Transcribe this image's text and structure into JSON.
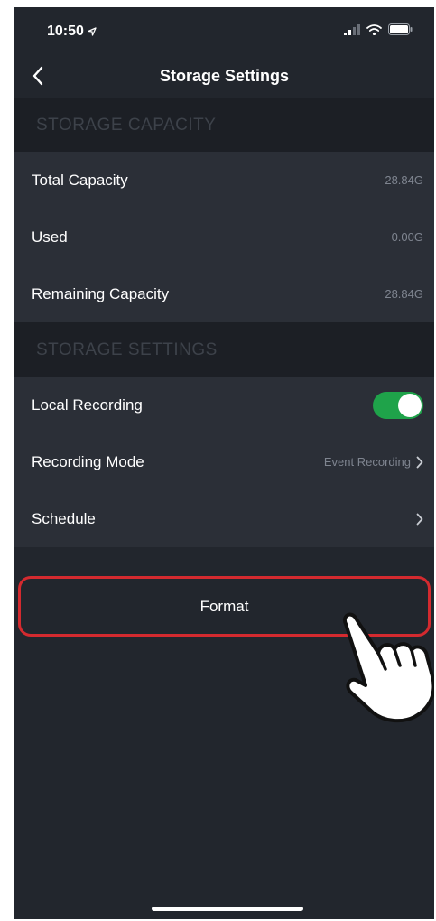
{
  "status_bar": {
    "time": "10:50"
  },
  "nav": {
    "title": "Storage Settings"
  },
  "storage_capacity": {
    "header": "STORAGE CAPACITY",
    "rows": [
      {
        "label": "Total Capacity",
        "value": "28.84G"
      },
      {
        "label": "Used",
        "value": "0.00G"
      },
      {
        "label": "Remaining Capacity",
        "value": "28.84G"
      }
    ]
  },
  "storage_settings": {
    "header": "STORAGE SETTINGS",
    "local_recording": {
      "label": "Local Recording",
      "enabled": true
    },
    "recording_mode": {
      "label": "Recording Mode",
      "value": "Event Recording"
    },
    "schedule": {
      "label": "Schedule"
    }
  },
  "format_button": {
    "label": "Format"
  },
  "colors": {
    "background": "#22262d",
    "row_background": "#2b2f37",
    "section_header_background": "#1c1f25",
    "toggle_on": "#1fa34a",
    "highlight_border": "#d42a2f"
  },
  "icons": [
    "location-arrow-icon",
    "signal-icon",
    "wifi-icon",
    "battery-icon",
    "back-chevron-icon",
    "chevron-right-icon",
    "pointing-hand-icon"
  ]
}
